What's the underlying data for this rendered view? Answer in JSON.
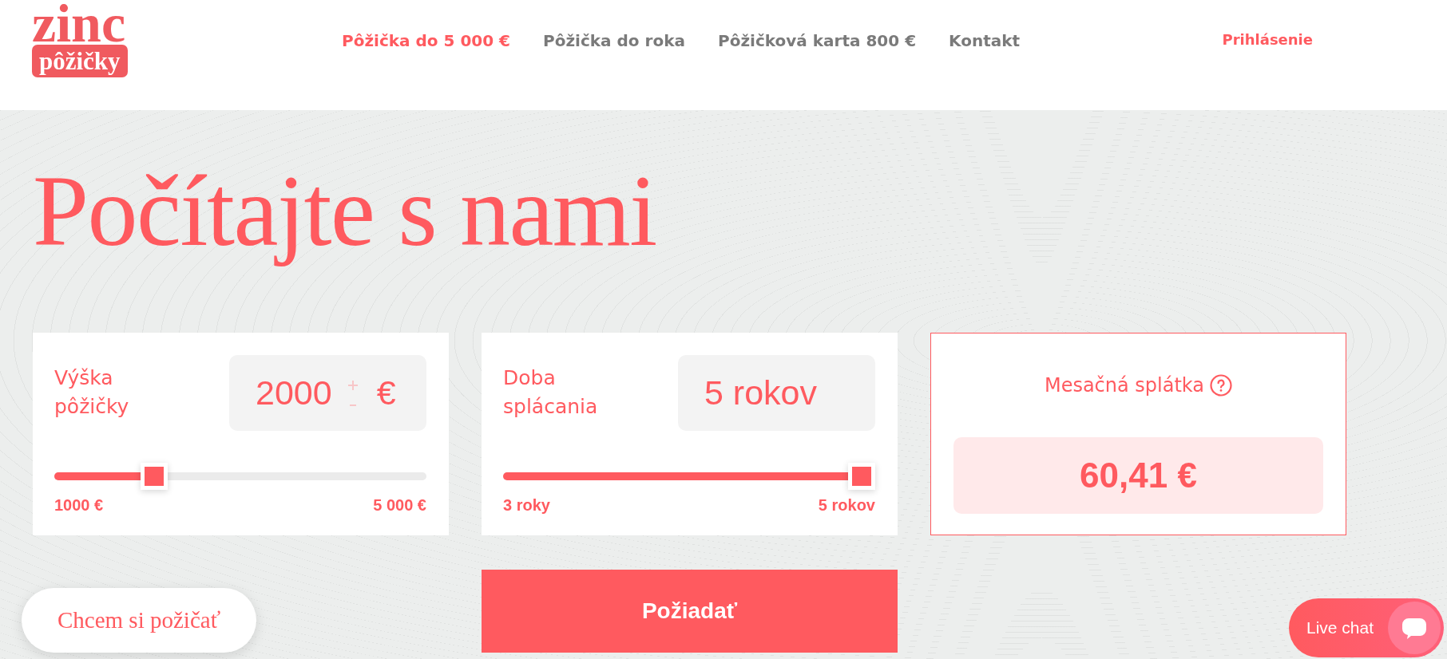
{
  "logo": {
    "wordmark": "zinc",
    "badge": "pôžičky"
  },
  "nav": {
    "items": [
      {
        "label": "Pôžička do 5 000 €",
        "selected": true
      },
      {
        "label": "Pôžička do roka",
        "selected": false
      },
      {
        "label": "Pôžičková karta 800 €",
        "selected": false
      },
      {
        "label": "Kontakt",
        "selected": false
      }
    ],
    "login": "Prihlásenie"
  },
  "hero": {
    "title": "Počítajte s nami"
  },
  "calculator": {
    "inputs": [
      {
        "label": "Výška pôžičky",
        "value": "2000",
        "unit": "€",
        "stepper": true,
        "level": 0.25,
        "min_label": "1000 €",
        "max_label": "5 000 €"
      },
      {
        "label": "Doba splácania",
        "value": "5 rokov",
        "stepper": false,
        "level": 1,
        "min_label": "3 roky",
        "max_label": "5 rokov"
      }
    ],
    "result": {
      "label": "Mesačná splátka",
      "value": "60,41 €"
    },
    "submit": "Požiadať"
  },
  "borrow_button": "Chcem si požičať",
  "live_chat": {
    "label": "Live chat"
  }
}
